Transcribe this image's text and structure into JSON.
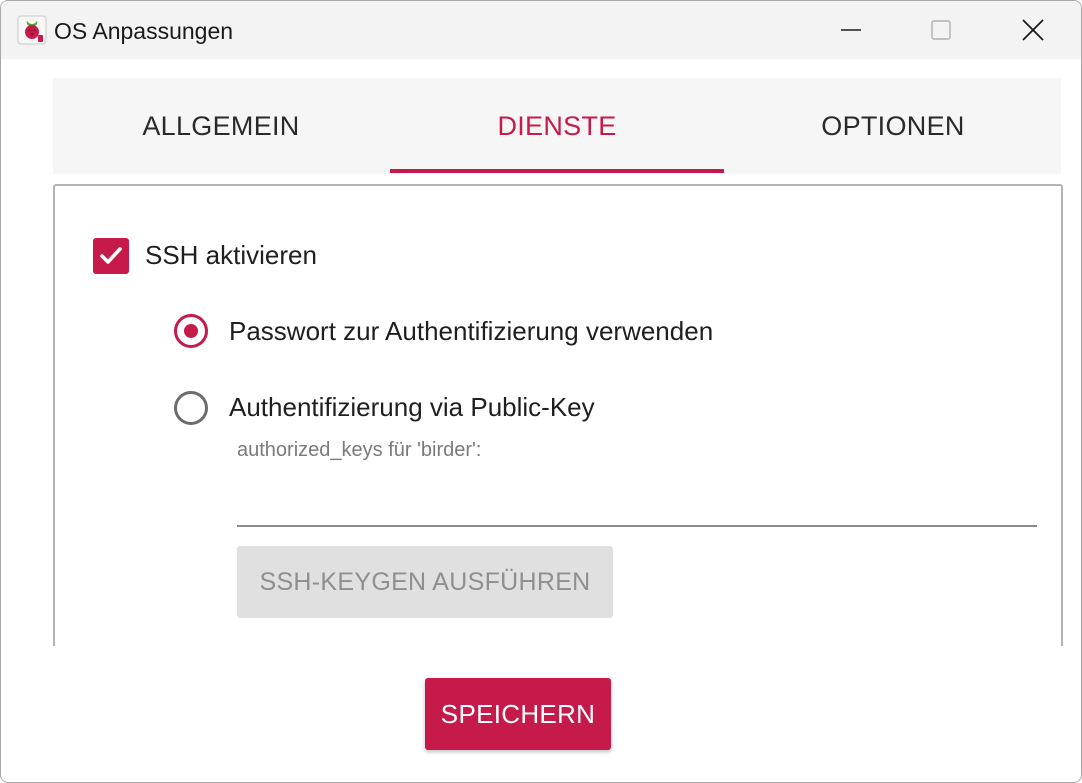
{
  "window": {
    "title": "OS Anpassungen",
    "app_icon": "raspberry-pi-imager-icon"
  },
  "controls": {
    "minimize_icon": "minimize-icon",
    "maximize_icon": "maximize-icon",
    "close_icon": "close-icon"
  },
  "tabs": [
    {
      "label": "ALLGEMEIN",
      "active": false
    },
    {
      "label": "DIENSTE",
      "active": true
    },
    {
      "label": "OPTIONEN",
      "active": false
    }
  ],
  "services": {
    "ssh_enable_label": "SSH aktivieren",
    "ssh_enabled": true,
    "auth_options": [
      {
        "label": "Passwort zur Authentifizierung verwenden",
        "selected": true
      },
      {
        "label": "Authentifizierung via Public-Key",
        "selected": false
      }
    ],
    "authorized_keys_label": "authorized_keys für 'birder':",
    "authorized_keys_value": "",
    "keygen_button_label": "SSH-KEYGEN AUSFÜHREN"
  },
  "footer": {
    "save_label": "SPEICHERN"
  },
  "colors": {
    "accent": "#c51a4a",
    "text": "#1f1f1f",
    "disabled_bg": "#e0e0e0",
    "disabled_text": "#8f8f8f"
  }
}
